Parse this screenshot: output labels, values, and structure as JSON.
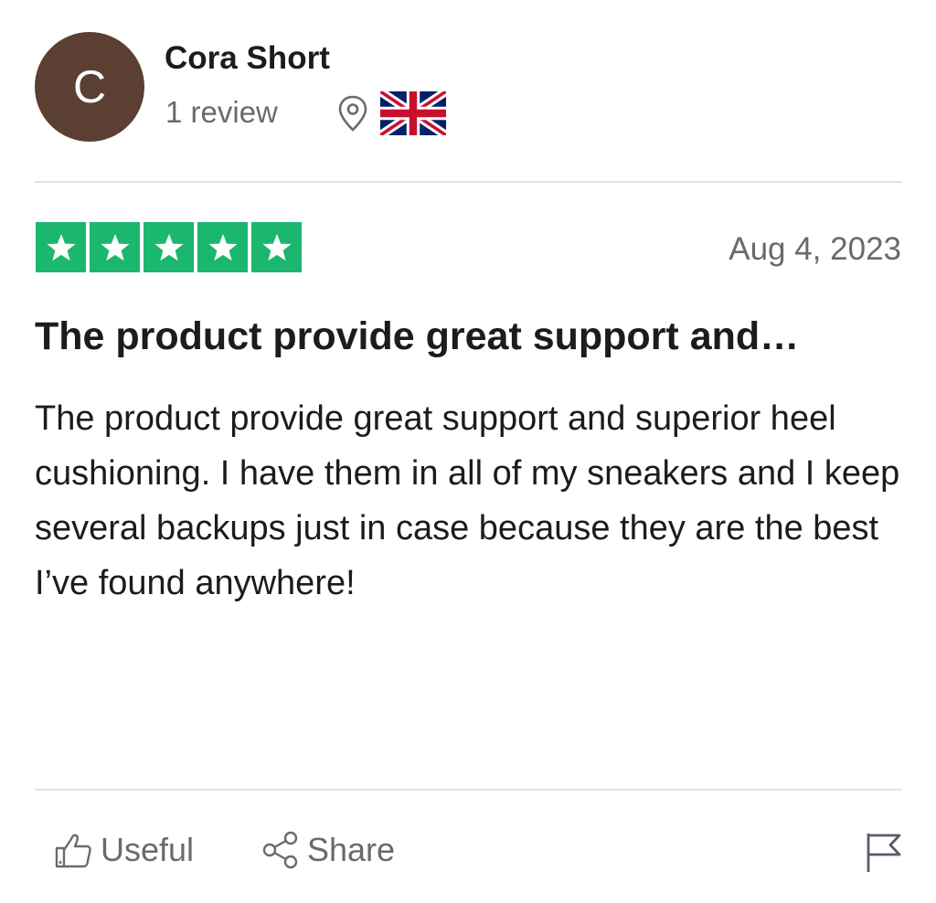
{
  "reviewer": {
    "initial": "C",
    "name": "Cora Short",
    "review_count": "1 review",
    "country_flag_icon": "uk-flag-icon",
    "location_icon": "map-pin-icon"
  },
  "review": {
    "rating": 5,
    "max_rating": 5,
    "date": "Aug 4, 2023",
    "title": "The product provide great support and…",
    "body": "The product provide great support and superior heel cushioning. I have them in all of my sneakers and I keep several backups just in case because they are the best I’ve found anywhere!"
  },
  "actions": {
    "useful_label": "Useful",
    "share_label": "Share",
    "useful_icon": "thumbs-up-icon",
    "share_icon": "share-icon",
    "report_icon": "flag-icon"
  },
  "colors": {
    "avatar_bg": "#5b3f33",
    "star_green": "#1bb76e",
    "muted_text": "#696a6a"
  }
}
